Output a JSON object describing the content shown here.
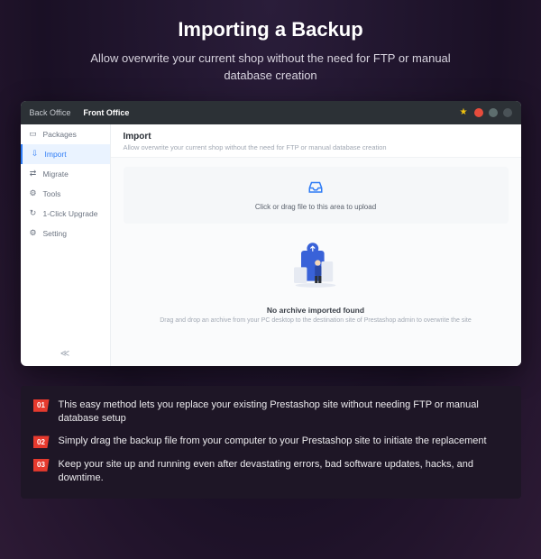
{
  "hero": {
    "title": "Importing a Backup",
    "subtitle": "Allow overwrite your current shop without the need for FTP or manual database creation"
  },
  "topbar": {
    "tabs": [
      "Back Office",
      "Front Office"
    ]
  },
  "sidebar": {
    "items": [
      {
        "label": "Packages"
      },
      {
        "label": "Import"
      },
      {
        "label": "Migrate"
      },
      {
        "label": "Tools"
      },
      {
        "label": "1-Click Upgrade"
      },
      {
        "label": "Setting"
      }
    ]
  },
  "main": {
    "title": "Import",
    "desc": "Allow overwrite your current shop without the need for FTP or manual database creation",
    "upload_text": "Click or drag file to this area to upload",
    "empty_title": "No archive imported found",
    "empty_sub": "Drag and drop an archive from your PC desktop to the destination site of Prestashop admin to overwrite the site"
  },
  "bullets": [
    {
      "num": "01",
      "text": "This easy method lets you replace your existing Prestashop site without needing FTP or manual database setup"
    },
    {
      "num": "02",
      "text": "Simply drag the backup file from your computer to your Prestashop site to initiate the replacement"
    },
    {
      "num": "03",
      "text": "Keep your site up and running even after devastating errors, bad software updates, hacks, and downtime."
    }
  ]
}
